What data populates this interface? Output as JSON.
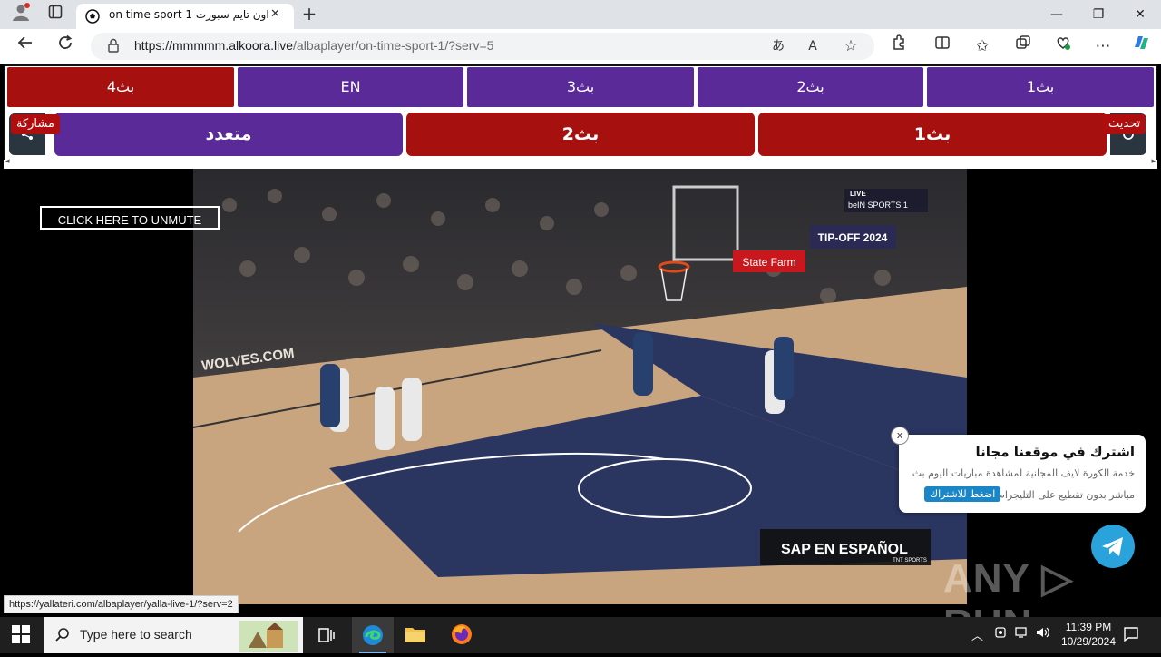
{
  "browser": {
    "tab_title": "on time sport 1 اون تايم سبورت",
    "new_tab_symbol": "+",
    "tab_close_symbol": "✕",
    "url_host": "https://mmmmm.alkoora.live",
    "url_path": "/albaplayer/on-time-sport-1/?serv=5",
    "window_minimize": "—",
    "window_restore": "❐",
    "window_close": "✕"
  },
  "servers_row1": [
    {
      "label": "بث4",
      "color": "#a6110f"
    },
    {
      "label": "EN",
      "color": "#5a2a99"
    },
    {
      "label": "بث3",
      "color": "#5a2a99"
    },
    {
      "label": "بث2",
      "color": "#5a2a99"
    },
    {
      "label": "بث1",
      "color": "#5a2a99"
    }
  ],
  "servers_row2": [
    {
      "label": "متعدد",
      "color": "#5a2a99"
    },
    {
      "label": "بث2",
      "color": "#a6110f"
    },
    {
      "label": "بث1",
      "color": "#a6110f"
    }
  ],
  "share_label": "مشاركة",
  "refresh_label": "تحديث",
  "unmute_label": "CLICK HERE TO UNMUTE",
  "video": {
    "channel_badge": "beIN SPORTS 1",
    "live_label": "LIVE",
    "sponsor": "State Farm",
    "event": "TIP-OFF 2024",
    "court_text": "WOLVES.COM",
    "broadcast_badge": "SAP EN ESPAÑOL",
    "tnt_label": "TNT SPORTS"
  },
  "popup": {
    "title": "اشترك في موقعنا مجانا",
    "text1": "خدمة الكورة لايف المجانية لمشاهدة مباريات اليوم بث",
    "text2": "مباشر بدون تقطيع على التليجرام",
    "button": "اضغط للاشتراك",
    "close": "x"
  },
  "status_link": "https://yallateri.com/albaplayer/yalla-live-1/?serv=2",
  "watermark": "ANY ▷ RUN",
  "taskbar": {
    "search_placeholder": "Type here to search",
    "time": "11:39 PM",
    "date": "10/29/2024"
  }
}
